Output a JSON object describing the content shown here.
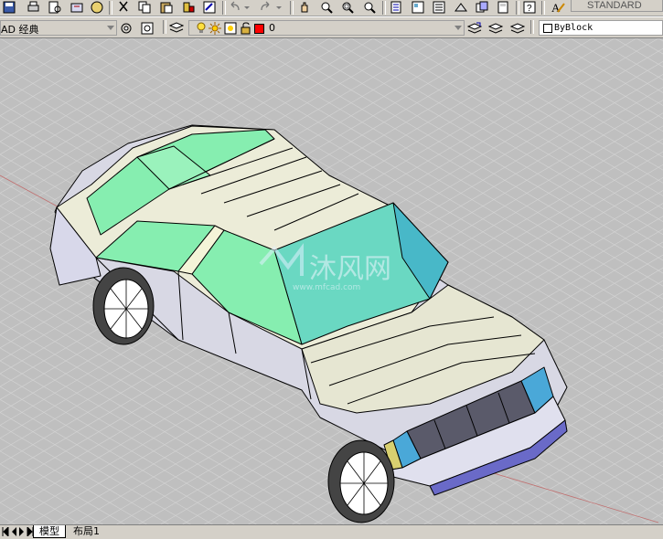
{
  "toolbar": {
    "text_style_value": "STANDARD"
  },
  "workspace": {
    "value": "AD 经典"
  },
  "layers": {
    "current_layer": "0",
    "layer_color": "#ff0000"
  },
  "properties": {
    "color_value": "ByBlock"
  },
  "watermark": {
    "text": "沐风网",
    "url": "www.mfcad.com"
  },
  "tabs": {
    "model": "模型",
    "layout1": "布局1"
  },
  "colors": {
    "viewport_bg": "#bfbfbf",
    "glass_green": "#7aeaa8",
    "glass_teal": "#5ad0c0",
    "body": "#e6e6d2",
    "body_shade": "#c9c9dc",
    "grille": "#5a5a6a",
    "headlight": "#4aa8d8"
  }
}
